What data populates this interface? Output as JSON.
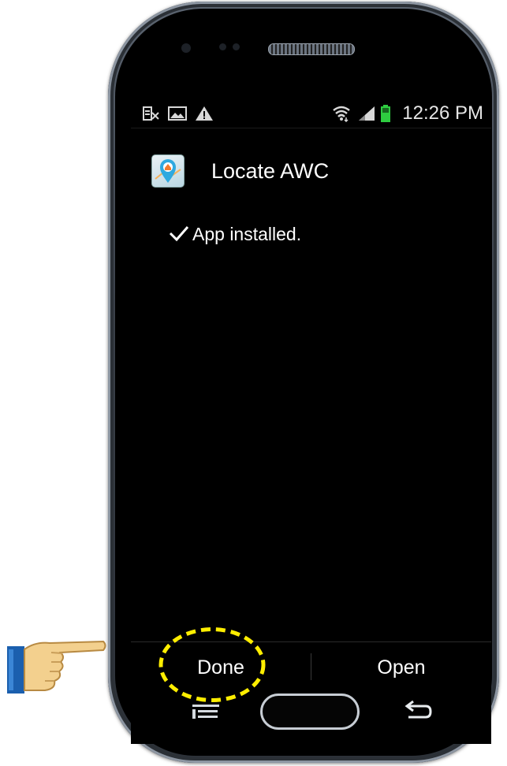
{
  "status_bar": {
    "time": "12:26 PM",
    "left_icons": [
      "news-icon",
      "image-icon",
      "warning-icon"
    ],
    "right_icons": [
      "wifi-icon",
      "signal-icon",
      "battery-icon"
    ]
  },
  "dialog": {
    "app_name": "Locate AWC",
    "message": "App installed.",
    "buttons": {
      "done_label": "Done",
      "open_label": "Open"
    }
  },
  "annotation": {
    "highlight_color": "#ffee00",
    "target": "Done"
  },
  "colors": {
    "screen_bg": "#000000",
    "text": "#ffffff",
    "battery": "#2ecc40"
  }
}
